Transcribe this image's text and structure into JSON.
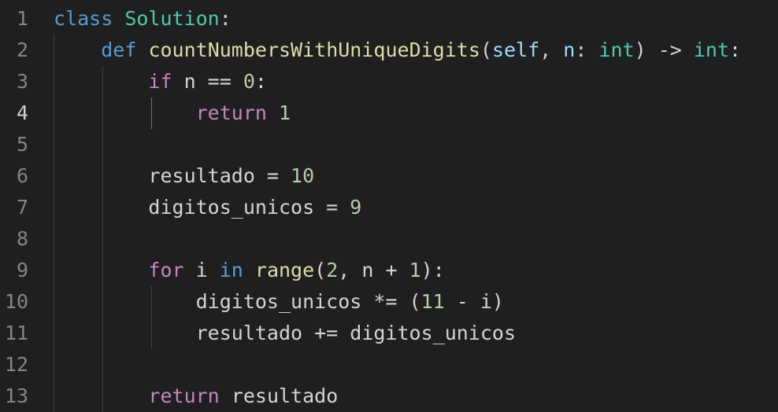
{
  "editor": {
    "language": "python",
    "active_line": 4,
    "colors": {
      "background": "#1f1f1f",
      "keyword": "#569cd6",
      "control": "#c586c0",
      "class_name": "#4ec9b0",
      "function": "#dcdcaa",
      "number": "#b5cea8",
      "parameter": "#9cdcfe",
      "text": "#d4d4d4",
      "line_number": "#858585"
    },
    "lines": [
      {
        "num": "1",
        "tokens": [
          {
            "t": "class",
            "c": "kw"
          },
          {
            "t": " "
          },
          {
            "t": "Solution",
            "c": "cls"
          },
          {
            "t": ":"
          }
        ]
      },
      {
        "num": "2",
        "tokens": [
          {
            "t": "    "
          },
          {
            "t": "def",
            "c": "kw"
          },
          {
            "t": " "
          },
          {
            "t": "countNumbersWithUniqueDigits",
            "c": "fn"
          },
          {
            "t": "("
          },
          {
            "t": "self",
            "c": "prm"
          },
          {
            "t": ", "
          },
          {
            "t": "n",
            "c": "prm"
          },
          {
            "t": ": "
          },
          {
            "t": "int",
            "c": "cls"
          },
          {
            "t": ") -> "
          },
          {
            "t": "int",
            "c": "cls"
          },
          {
            "t": ":"
          }
        ]
      },
      {
        "num": "3",
        "tokens": [
          {
            "t": "        "
          },
          {
            "t": "if",
            "c": "ctl"
          },
          {
            "t": " n == "
          },
          {
            "t": "0",
            "c": "num"
          },
          {
            "t": ":"
          }
        ]
      },
      {
        "num": "4",
        "tokens": [
          {
            "t": "            "
          },
          {
            "t": "return",
            "c": "ctl"
          },
          {
            "t": " "
          },
          {
            "t": "1",
            "c": "num"
          }
        ]
      },
      {
        "num": "5",
        "tokens": []
      },
      {
        "num": "6",
        "tokens": [
          {
            "t": "        resultado = "
          },
          {
            "t": "10",
            "c": "num"
          }
        ]
      },
      {
        "num": "7",
        "tokens": [
          {
            "t": "        digitos_unicos = "
          },
          {
            "t": "9",
            "c": "num"
          }
        ]
      },
      {
        "num": "8",
        "tokens": []
      },
      {
        "num": "9",
        "tokens": [
          {
            "t": "        "
          },
          {
            "t": "for",
            "c": "ctl"
          },
          {
            "t": " i "
          },
          {
            "t": "in",
            "c": "kw"
          },
          {
            "t": " "
          },
          {
            "t": "range",
            "c": "fn"
          },
          {
            "t": "("
          },
          {
            "t": "2",
            "c": "num"
          },
          {
            "t": ", n + "
          },
          {
            "t": "1",
            "c": "num"
          },
          {
            "t": "):"
          }
        ]
      },
      {
        "num": "10",
        "tokens": [
          {
            "t": "            digitos_unicos *= ("
          },
          {
            "t": "11",
            "c": "num"
          },
          {
            "t": " - i)"
          }
        ]
      },
      {
        "num": "11",
        "tokens": [
          {
            "t": "            resultado += digitos_unicos"
          }
        ]
      },
      {
        "num": "12",
        "tokens": []
      },
      {
        "num": "13",
        "tokens": [
          {
            "t": "        "
          },
          {
            "t": "return",
            "c": "ctl"
          },
          {
            "t": " resultado"
          }
        ]
      }
    ]
  }
}
